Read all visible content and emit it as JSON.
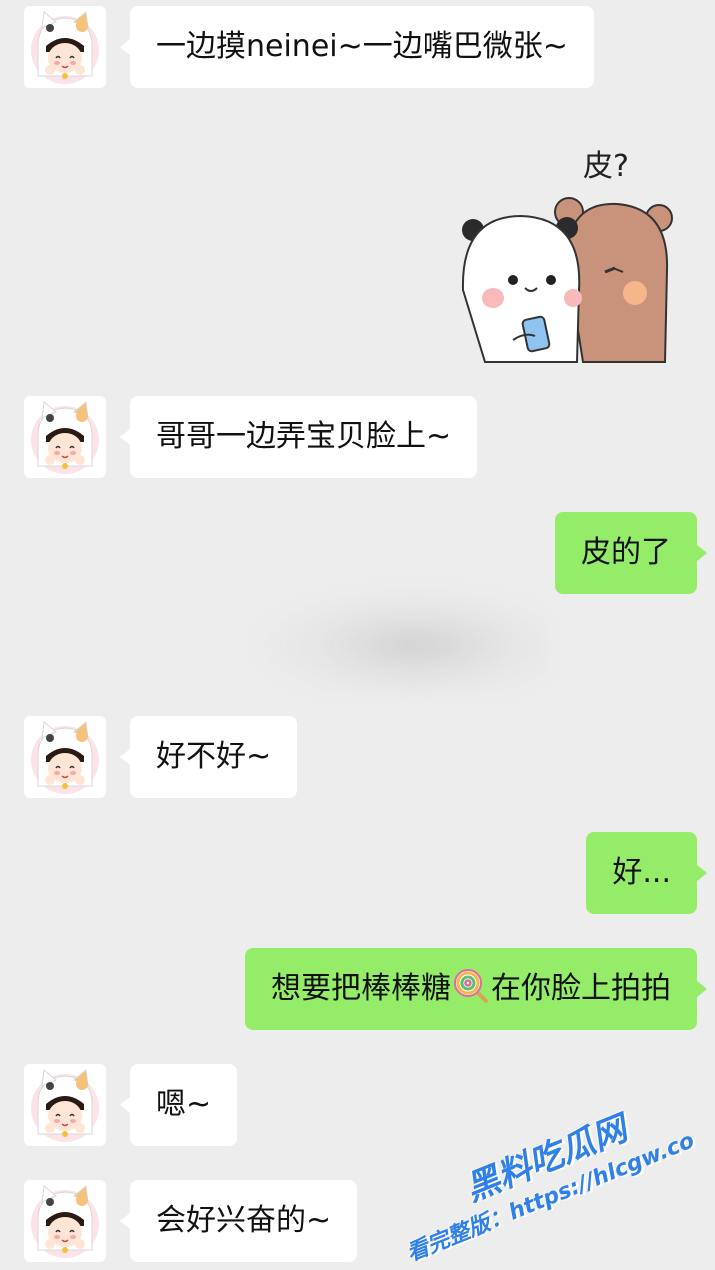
{
  "messages": [
    {
      "side": "in",
      "text": "一边摸neinei~一边嘴巴微张~"
    },
    {
      "side": "out",
      "sticker": "panda-bear-sticker",
      "sticker_caption": "皮?"
    },
    {
      "side": "in",
      "text": "哥哥一边弄宝贝脸上~"
    },
    {
      "side": "out",
      "text": "皮的了"
    },
    {
      "side": "out",
      "sticker": "blurred-sticker"
    },
    {
      "side": "in",
      "text": "好不好~"
    },
    {
      "side": "out",
      "text": "好..."
    },
    {
      "side": "out",
      "text_before": "想要把棒棒糖",
      "emoji": "lollipop-emoji",
      "text_after": "在你脸上拍拍"
    },
    {
      "side": "in",
      "text": "嗯~"
    },
    {
      "side": "in",
      "text": "会好兴奋的~"
    }
  ],
  "watermark": {
    "line1": "黑料吃瓜网",
    "line2": "看完整版：https://hlcgw.co"
  },
  "colors": {
    "background": "#ededed",
    "incoming_bubble": "#ffffff",
    "outgoing_bubble": "#95ec69",
    "watermark": "#2f80e8"
  }
}
